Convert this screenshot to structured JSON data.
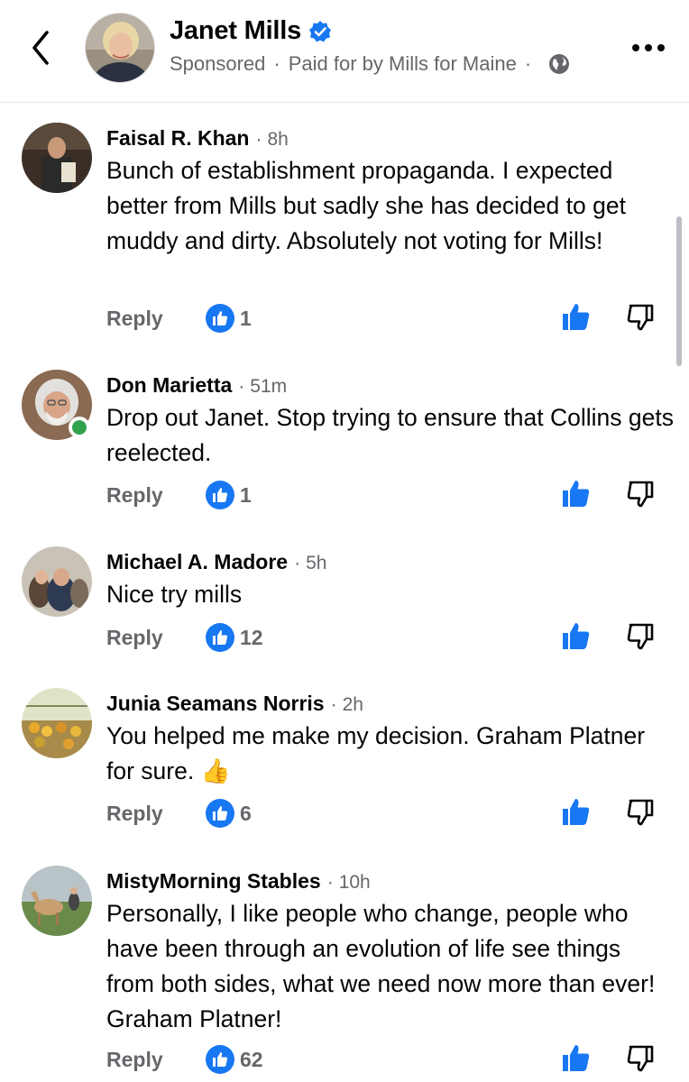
{
  "header": {
    "page_name": "Janet Mills",
    "sponsored": "Sponsored",
    "separator": "·",
    "paid_for": "Paid for by Mills for Maine"
  },
  "colors": {
    "accent": "#1877f2",
    "secondary_text": "#65676b",
    "online": "#31a24c"
  },
  "comments": [
    {
      "name": "Faisal R. Khan",
      "time": "8h",
      "text": "Bunch of establishment propaganda. I expected better from Mills but sadly she has decided to get muddy and dirty. Absolutely not voting for Mills!",
      "reply": "Reply",
      "likes": "1"
    },
    {
      "name": "Don Marietta",
      "time": "51m",
      "text": "Drop out Janet. Stop trying to ensure that Collins gets reelected.",
      "reply": "Reply",
      "likes": "1"
    },
    {
      "name": "Michael A. Madore",
      "time": "5h",
      "text": "Nice try mills",
      "reply": "Reply",
      "likes": "12"
    },
    {
      "name": "Junia Seamans Norris",
      "time": "2h",
      "text": "You helped me make my decision. Graham Platner for sure.",
      "emoji": "👍",
      "reply": "Reply",
      "likes": "6"
    },
    {
      "name": "MistyMorning Stables",
      "time": "10h",
      "text": "Personally, I like people who change, people who have been through an evolution of life see things from both sides, what we need now more than ever! Graham Platner!",
      "reply": "Reply",
      "likes": "62"
    }
  ],
  "icons": [
    "back-arrow-icon",
    "verified-badge-icon",
    "globe-icon",
    "more-options-icon",
    "like-reaction-icon",
    "thumbs-up-icon",
    "thumbs-down-icon"
  ]
}
